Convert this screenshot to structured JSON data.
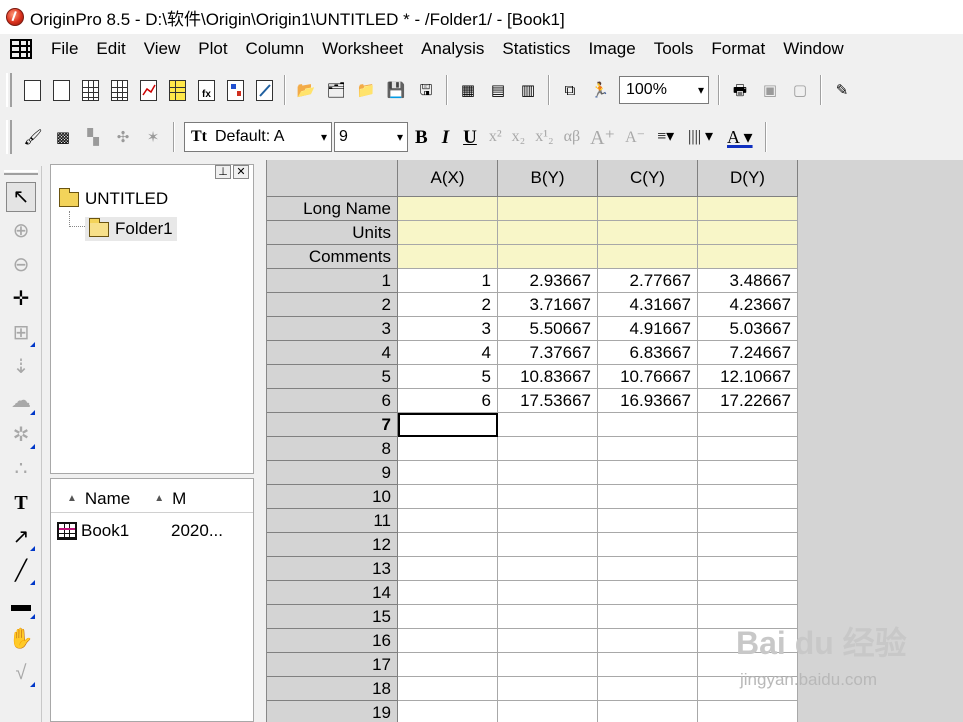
{
  "window": {
    "title": "OriginPro 8.5 - D:\\软件\\Origin\\Origin1\\UNTITLED * - /Folder1/ - [Book1]"
  },
  "menu": [
    "File",
    "Edit",
    "View",
    "Plot",
    "Column",
    "Worksheet",
    "Analysis",
    "Statistics",
    "Image",
    "Tools",
    "Format",
    "Window"
  ],
  "toolbar": {
    "zoom_value": "100%"
  },
  "format_bar": {
    "font_value": "Default: A",
    "size_value": "9"
  },
  "explorer": {
    "root": "UNTITLED",
    "folder": "Folder1",
    "columns": {
      "name": "Name",
      "modified": "M"
    },
    "items": [
      {
        "name": "Book1",
        "modified": "2020..."
      }
    ]
  },
  "worksheet": {
    "columns": [
      "A(X)",
      "B(Y)",
      "C(Y)",
      "D(Y)"
    ],
    "meta_rows": [
      "Long Name",
      "Units",
      "Comments"
    ],
    "rows": [
      {
        "label": "1",
        "cells": [
          "1",
          "2.93667",
          "2.77667",
          "3.48667"
        ]
      },
      {
        "label": "2",
        "cells": [
          "2",
          "3.71667",
          "4.31667",
          "4.23667"
        ]
      },
      {
        "label": "3",
        "cells": [
          "3",
          "5.50667",
          "4.91667",
          "5.03667"
        ]
      },
      {
        "label": "4",
        "cells": [
          "4",
          "7.37667",
          "6.83667",
          "7.24667"
        ]
      },
      {
        "label": "5",
        "cells": [
          "5",
          "10.83667",
          "10.76667",
          "12.10667"
        ]
      },
      {
        "label": "6",
        "cells": [
          "6",
          "17.53667",
          "16.93667",
          "17.22667"
        ]
      },
      {
        "label": "7",
        "cells": [
          "",
          "",
          "",
          ""
        ]
      },
      {
        "label": "8",
        "cells": [
          "",
          "",
          "",
          ""
        ]
      },
      {
        "label": "9",
        "cells": [
          "",
          "",
          "",
          ""
        ]
      },
      {
        "label": "10",
        "cells": [
          "",
          "",
          "",
          ""
        ]
      },
      {
        "label": "11",
        "cells": [
          "",
          "",
          "",
          ""
        ]
      },
      {
        "label": "12",
        "cells": [
          "",
          "",
          "",
          ""
        ]
      },
      {
        "label": "13",
        "cells": [
          "",
          "",
          "",
          ""
        ]
      },
      {
        "label": "14",
        "cells": [
          "",
          "",
          "",
          ""
        ]
      },
      {
        "label": "15",
        "cells": [
          "",
          "",
          "",
          ""
        ]
      },
      {
        "label": "16",
        "cells": [
          "",
          "",
          "",
          ""
        ]
      },
      {
        "label": "17",
        "cells": [
          "",
          "",
          "",
          ""
        ]
      },
      {
        "label": "18",
        "cells": [
          "",
          "",
          "",
          ""
        ]
      },
      {
        "label": "19",
        "cells": [
          "",
          "",
          "",
          ""
        ]
      }
    ],
    "active_row": "7"
  },
  "watermark": {
    "brand": "Bai du 经验",
    "url": "jingyan.baidu.com"
  }
}
